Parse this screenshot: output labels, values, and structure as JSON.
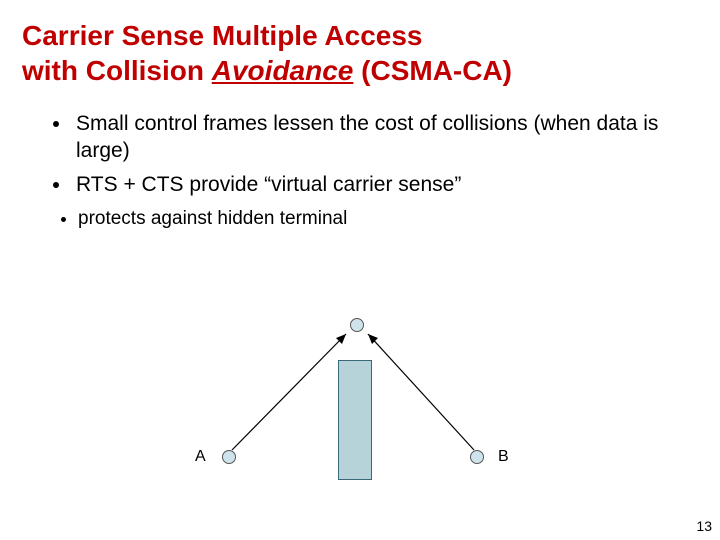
{
  "title_part1": "Carrier Sense Multiple Access",
  "title_part2a": "with Collision ",
  "title_part2b": "Avoidance",
  "title_part2c": " (CSMA-CA)",
  "bullets": [
    "Small control frames lessen the cost of collisions (when data is large)",
    "RTS + CTS provide “virtual carrier sense”"
  ],
  "subbullets": [
    "protects against hidden terminal"
  ],
  "labels": {
    "a": "A",
    "b": "B"
  },
  "page_number": "13"
}
